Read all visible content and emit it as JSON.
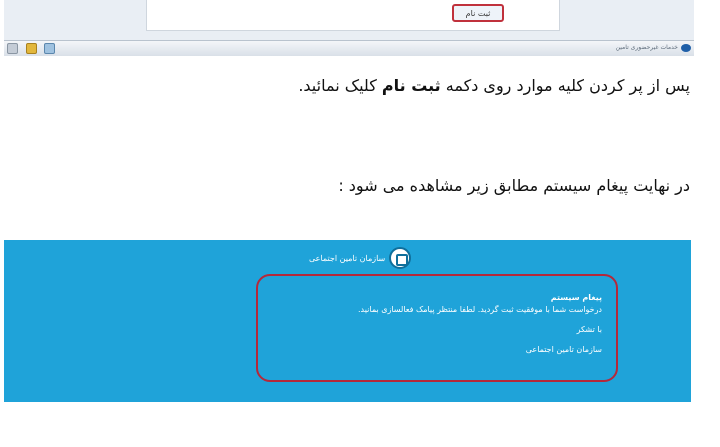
{
  "top_screenshot": {
    "register_button_label": "ثبت نام",
    "taskbar_label": "خدمات غیرحضوری تامین"
  },
  "instruction_1": {
    "before": "پس از پر کردن کلیه موارد روی دکمه ",
    "bold": "ثبت نام",
    "after": " کلیک نمائید."
  },
  "instruction_2": {
    "text": "در نهایت پیغام سیستم مطابق زیر مشاهده می شود :"
  },
  "message_screenshot": {
    "org_name": "سازمان تامین اجتماعی",
    "message_title": "پیغام سیستم",
    "message_body": "درخواست شما با موفقیت ثبت گردید. لطفا منتظر پیامک فعالسازی بمانید.",
    "thanks": "با تشکر",
    "signature": "سازمان تامین اجتماعی"
  },
  "colors": {
    "message_background": "#1fa3d9",
    "highlight_border": "#b5283a"
  }
}
